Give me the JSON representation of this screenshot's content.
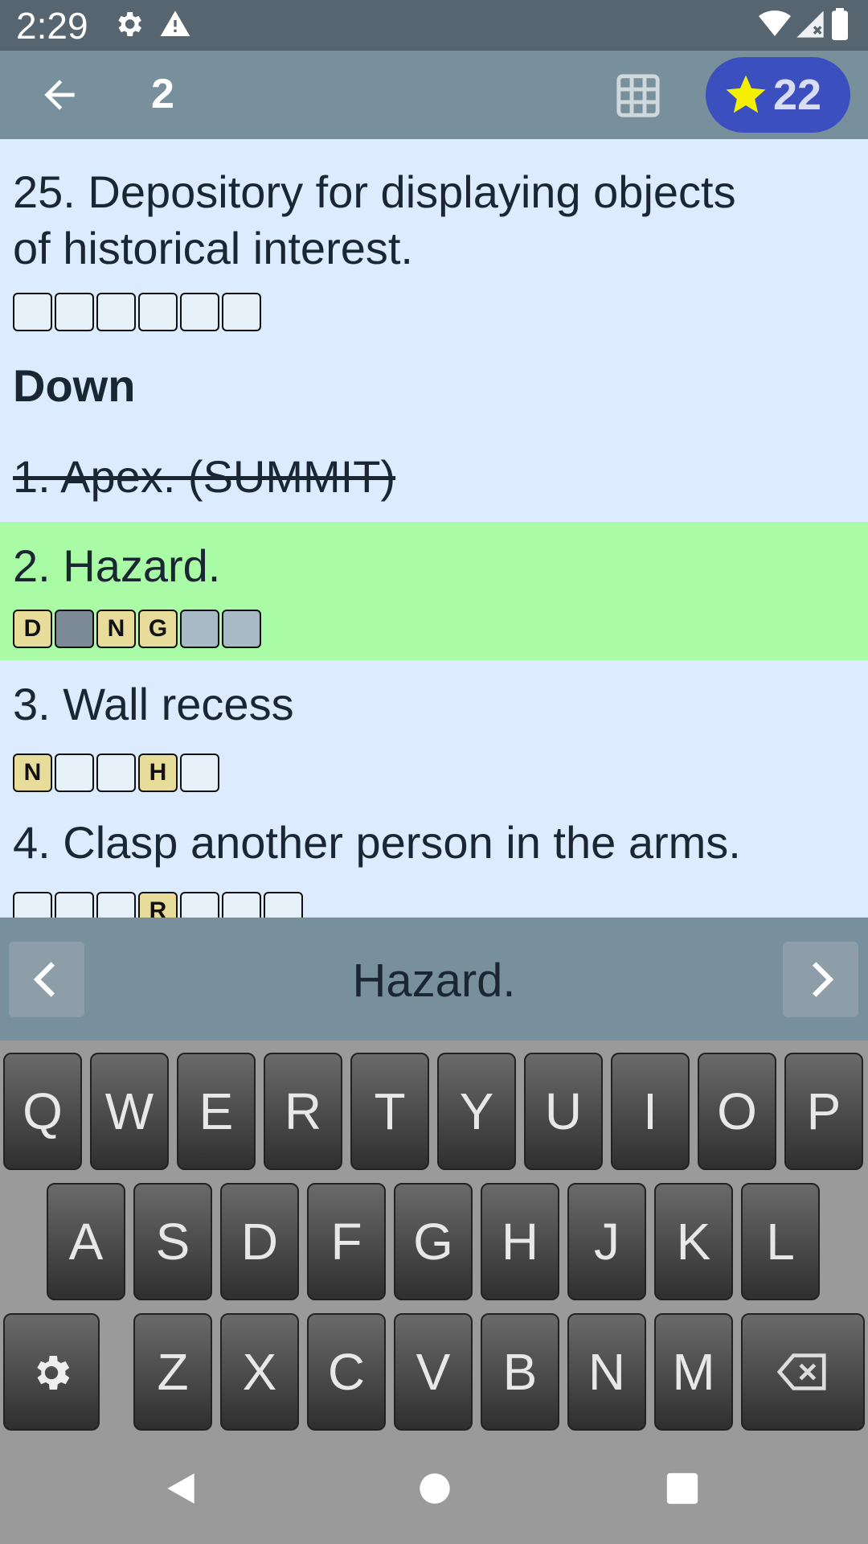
{
  "status": {
    "time": "2:29"
  },
  "appbar": {
    "clue_number": "2",
    "score": "22"
  },
  "clues": {
    "clue_25": {
      "text_line1": "25. Depository for displaying objects",
      "text_line2": "of historical interest.",
      "boxes": [
        "",
        "",
        "",
        "",
        "",
        ""
      ]
    },
    "down_heading": "Down",
    "clue_1": {
      "text": "1. Apex. (SUMMIT)"
    },
    "clue_2": {
      "text": "2. Hazard.",
      "boxes": [
        "D",
        "",
        "N",
        "G",
        "",
        ""
      ]
    },
    "clue_3": {
      "text": "3. Wall recess",
      "boxes": [
        "N",
        "",
        "",
        "H",
        ""
      ]
    },
    "clue_4": {
      "text": "4. Clasp another person in the arms.",
      "boxes": [
        "",
        "",
        "",
        "R",
        "",
        "",
        ""
      ]
    }
  },
  "hint": {
    "text": "Hazard."
  },
  "keyboard": {
    "row1": [
      "Q",
      "W",
      "E",
      "R",
      "T",
      "Y",
      "U",
      "I",
      "O",
      "P"
    ],
    "row2": [
      "A",
      "S",
      "D",
      "F",
      "G",
      "H",
      "J",
      "K",
      "L"
    ],
    "row3": [
      "Z",
      "X",
      "C",
      "V",
      "B",
      "N",
      "M"
    ]
  },
  "colors": {
    "highlight": "#aafba5",
    "list_bg": "#dcebfd",
    "appbar": "#78909c",
    "score_pill": "#3b4fbe",
    "filled_box": "#e8dc9a"
  }
}
